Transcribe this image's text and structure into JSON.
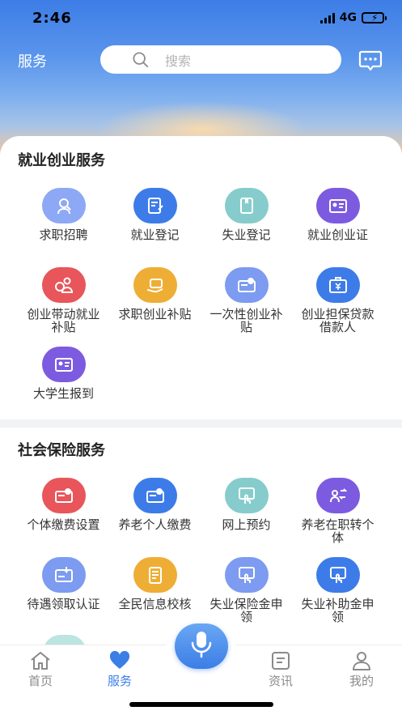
{
  "status": {
    "time": "2:46",
    "network": "4G"
  },
  "header": {
    "title": "服务",
    "search_placeholder": "搜索"
  },
  "sections": [
    {
      "title": "就业创业服务",
      "items": [
        {
          "label": "求职招聘",
          "icon": "job-search-icon",
          "color": "#8da8f5"
        },
        {
          "label": "就业登记",
          "icon": "edit-form-icon",
          "color": "#3d7ce8"
        },
        {
          "label": "失业登记",
          "icon": "book-icon",
          "color": "#86cccc"
        },
        {
          "label": "就业创业证",
          "icon": "id-card-icon",
          "color": "#7c5be0"
        },
        {
          "label": "创业带动就业补贴",
          "icon": "subsidy-person-icon",
          "color": "#e8555a"
        },
        {
          "label": "求职创业补贴",
          "icon": "briefcase-hand-icon",
          "color": "#eeae35"
        },
        {
          "label": "一次性创业补贴",
          "icon": "yuan-card-icon",
          "color": "#7d9bf0"
        },
        {
          "label": "创业担保贷款借款人",
          "icon": "yuan-briefcase-icon",
          "color": "#3d7ce8"
        },
        {
          "label": "大学生报到",
          "icon": "id-card-icon",
          "color": "#7c5be0"
        }
      ]
    },
    {
      "title": "社会保险服务",
      "items": [
        {
          "label": "个体缴费设置",
          "icon": "yuan-card-icon",
          "color": "#e8555a"
        },
        {
          "label": "养老个人缴费",
          "icon": "yuan-card-icon",
          "color": "#3d7ce8"
        },
        {
          "label": "网上预约",
          "icon": "hand-touch-icon",
          "color": "#86cccc"
        },
        {
          "label": "养老在职转个体",
          "icon": "transfer-user-icon",
          "color": "#7c5be0"
        },
        {
          "label": "待遇领取认证",
          "icon": "verify-card-icon",
          "color": "#7d9bf0"
        },
        {
          "label": "全民信息校核",
          "icon": "checklist-icon",
          "color": "#eeae35"
        },
        {
          "label": "失业保险金申领",
          "icon": "hand-touch-icon",
          "color": "#7d9bf0"
        },
        {
          "label": "失业补助金申领",
          "icon": "hand-touch-icon",
          "color": "#3d7ce8"
        }
      ]
    }
  ],
  "tabbar": {
    "home": "首页",
    "service": "服务",
    "news": "资讯",
    "mine": "我的"
  }
}
